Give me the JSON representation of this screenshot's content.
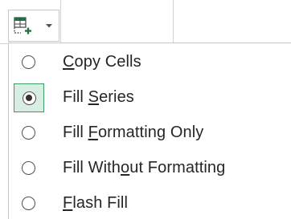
{
  "smart_tag": {
    "icon": "auto-fill-options-icon",
    "dropdown_icon": "chevron-down-icon"
  },
  "menu": {
    "items": [
      {
        "pre": "",
        "key": "C",
        "post": "opy Cells",
        "selected": false
      },
      {
        "pre": "Fill ",
        "key": "S",
        "post": "eries",
        "selected": true
      },
      {
        "pre": "Fill ",
        "key": "F",
        "post": "ormatting Only",
        "selected": false
      },
      {
        "pre": "Fill With",
        "key": "o",
        "post": "ut Formatting",
        "selected": false
      },
      {
        "pre": "",
        "key": "F",
        "post": "lash Fill",
        "selected": false
      }
    ]
  },
  "colors": {
    "selected_fill": "#d9eee2",
    "selected_border": "#3e9967",
    "icon_green": "#217346"
  }
}
